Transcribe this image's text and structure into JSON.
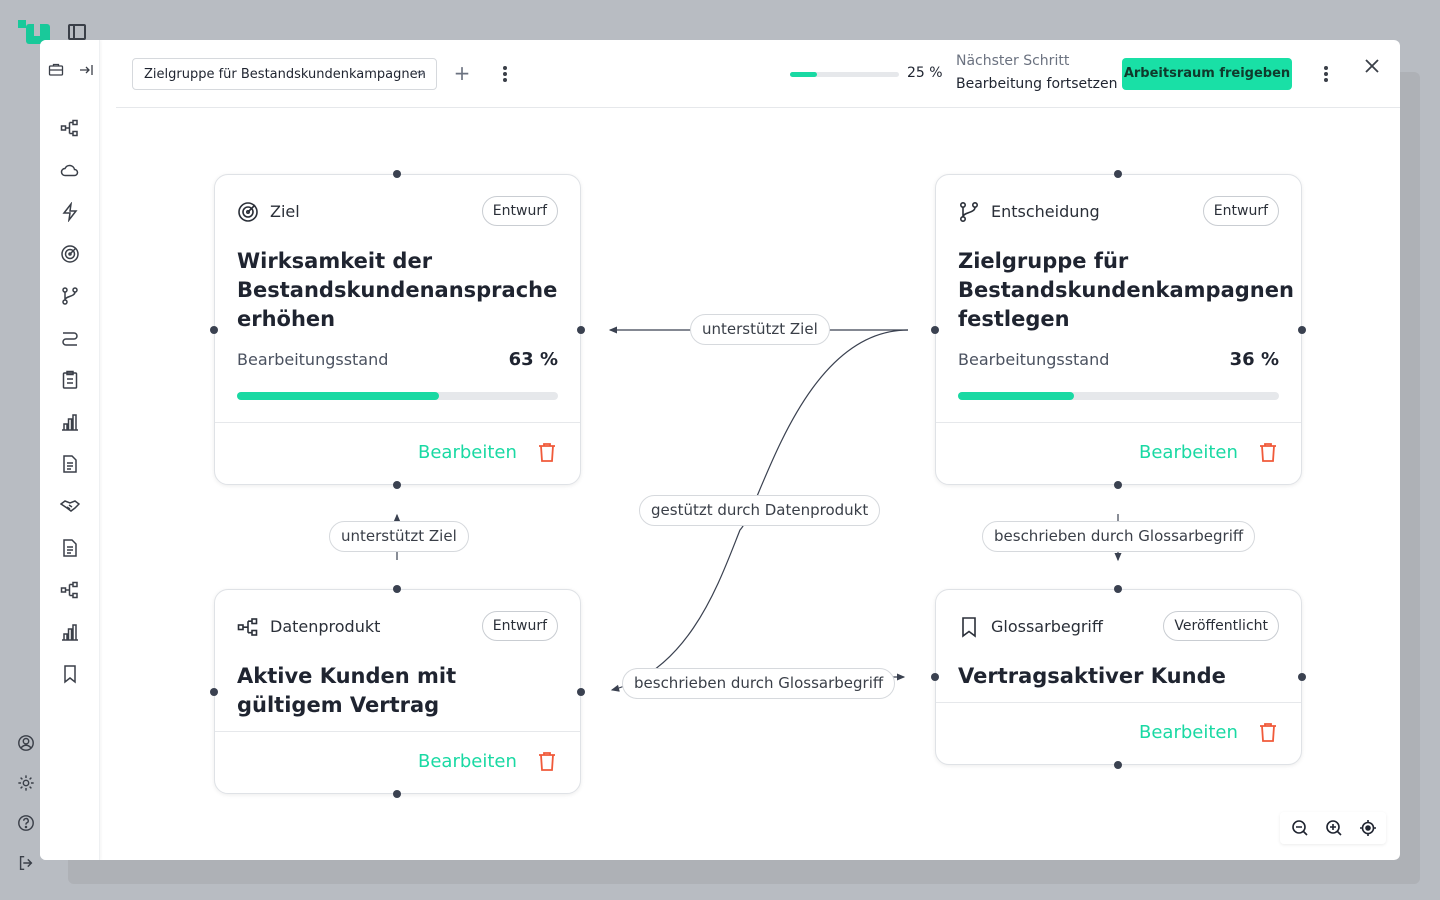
{
  "modal": {
    "selector_value": "Zielgruppe für Bestandskundenkampagnen",
    "progress_percent": 25,
    "progress_label": "25 %",
    "next_step_label": "Nächster Schritt",
    "next_step_value": "Bearbeitung fortsetzen",
    "share_label": "Arbeitsraum freigeben",
    "add_icon": "plus-icon",
    "close_icon": "close-icon"
  },
  "rail": {
    "top_icons": [
      "briefcase-icon",
      "collapse-icon"
    ],
    "items": [
      "data-product-icon",
      "cloud-icon",
      "bolt-icon",
      "target-icon",
      "branch-icon",
      "route-icon",
      "clipboard-icon",
      "chart-icon",
      "document-icon",
      "handshake-icon",
      "document-icon",
      "data-product-icon",
      "chart-icon",
      "bookmark-icon"
    ]
  },
  "nodes": {
    "ziel": {
      "type": "Ziel",
      "badge": "Entwurf",
      "title": "Wirksamkeit der Bestandskundenansprache erhöhen",
      "progress_label": "Bearbeitungsstand",
      "progress_value": "63 %",
      "progress": 63,
      "edit_label": "Bearbeiten",
      "icon": "target-icon"
    },
    "entscheidung": {
      "type": "Entscheidung",
      "badge": "Entwurf",
      "title": "Zielgruppe für Bestandskundenkampagnen festlegen",
      "progress_label": "Bearbeitungsstand",
      "progress_value": "36 %",
      "progress": 36,
      "edit_label": "Bearbeiten",
      "icon": "branch-icon"
    },
    "datenprodukt": {
      "type": "Datenprodukt",
      "badge": "Entwurf",
      "title": "Aktive Kunden mit gültigem Vertrag",
      "edit_label": "Bearbeiten",
      "icon": "data-product-icon"
    },
    "glossar": {
      "type": "Glossarbegriff",
      "badge": "Veröffentlicht",
      "title": "Vertragsaktiver Kunde",
      "edit_label": "Bearbeiten",
      "icon": "bookmark-icon"
    }
  },
  "edges": {
    "top": "unterstützt Ziel",
    "left": "unterstützt Ziel",
    "middle": "gestützt durch Datenprodukt",
    "right": "beschrieben durch Glossarbegriff",
    "bottom": "beschrieben durch Glossarbegriff"
  },
  "zoom": [
    "zoom-out-icon",
    "zoom-in-icon",
    "fit-view-icon"
  ],
  "colors": {
    "accent": "#19d9a3",
    "danger": "#f05a3a"
  }
}
